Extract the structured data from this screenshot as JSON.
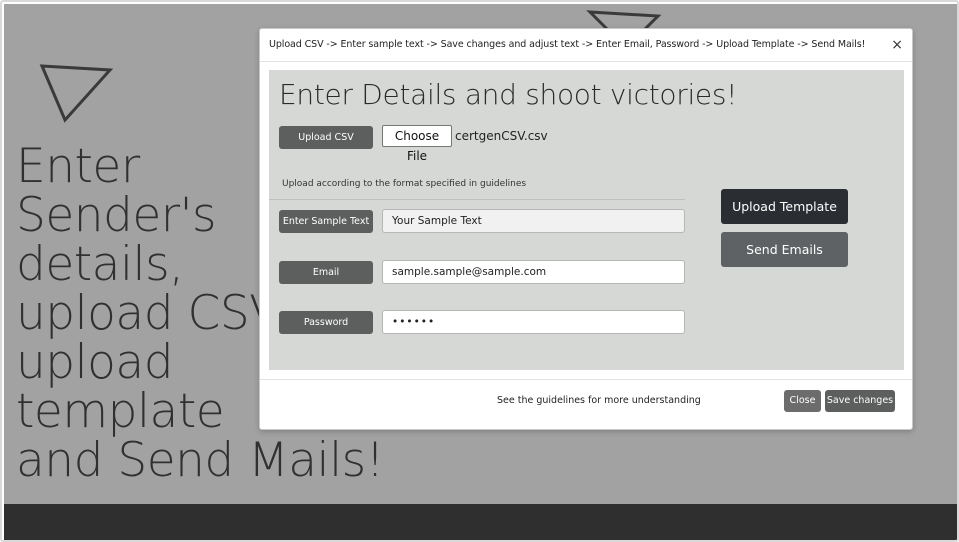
{
  "hero": {
    "lines": [
      "Enter",
      "Sender's",
      "details,",
      "upload CSV ,",
      "upload",
      "template",
      "and Send Mails!"
    ]
  },
  "modal": {
    "title": "Upload CSV -> Enter sample text -> Save changes and adjust text -> Enter Email, Password -> Upload Template -> Send Mails!",
    "close_glyph": "×",
    "heading": "Enter Details and shoot victories!",
    "upload_csv_label": "Upload CSV",
    "choose_file_label": "Choose File",
    "file_name": "certgenCSV.csv",
    "hint": "Upload according to the format specified in guidelines",
    "sample_label": "Enter Sample Text",
    "sample_value": "Your Sample Text",
    "email_label": "Email",
    "email_value": "sample.sample@sample.com",
    "password_label": "Password",
    "password_value": "••••••",
    "upload_template_label": "Upload Template",
    "send_emails_label": "Send Emails",
    "footer_text": "See the guidelines for more understanding",
    "close_label": "Close",
    "save_label": "Save changes"
  },
  "colors": {
    "page_bg": "#a2a2a2",
    "footer_bar": "#2f2f2f",
    "modal_body": "#d6d8d6",
    "primary_dark": "#2a2e33",
    "button_gray": "#5d5e5e"
  },
  "icons": [
    "triangle-outline-icon",
    "close-icon"
  ]
}
